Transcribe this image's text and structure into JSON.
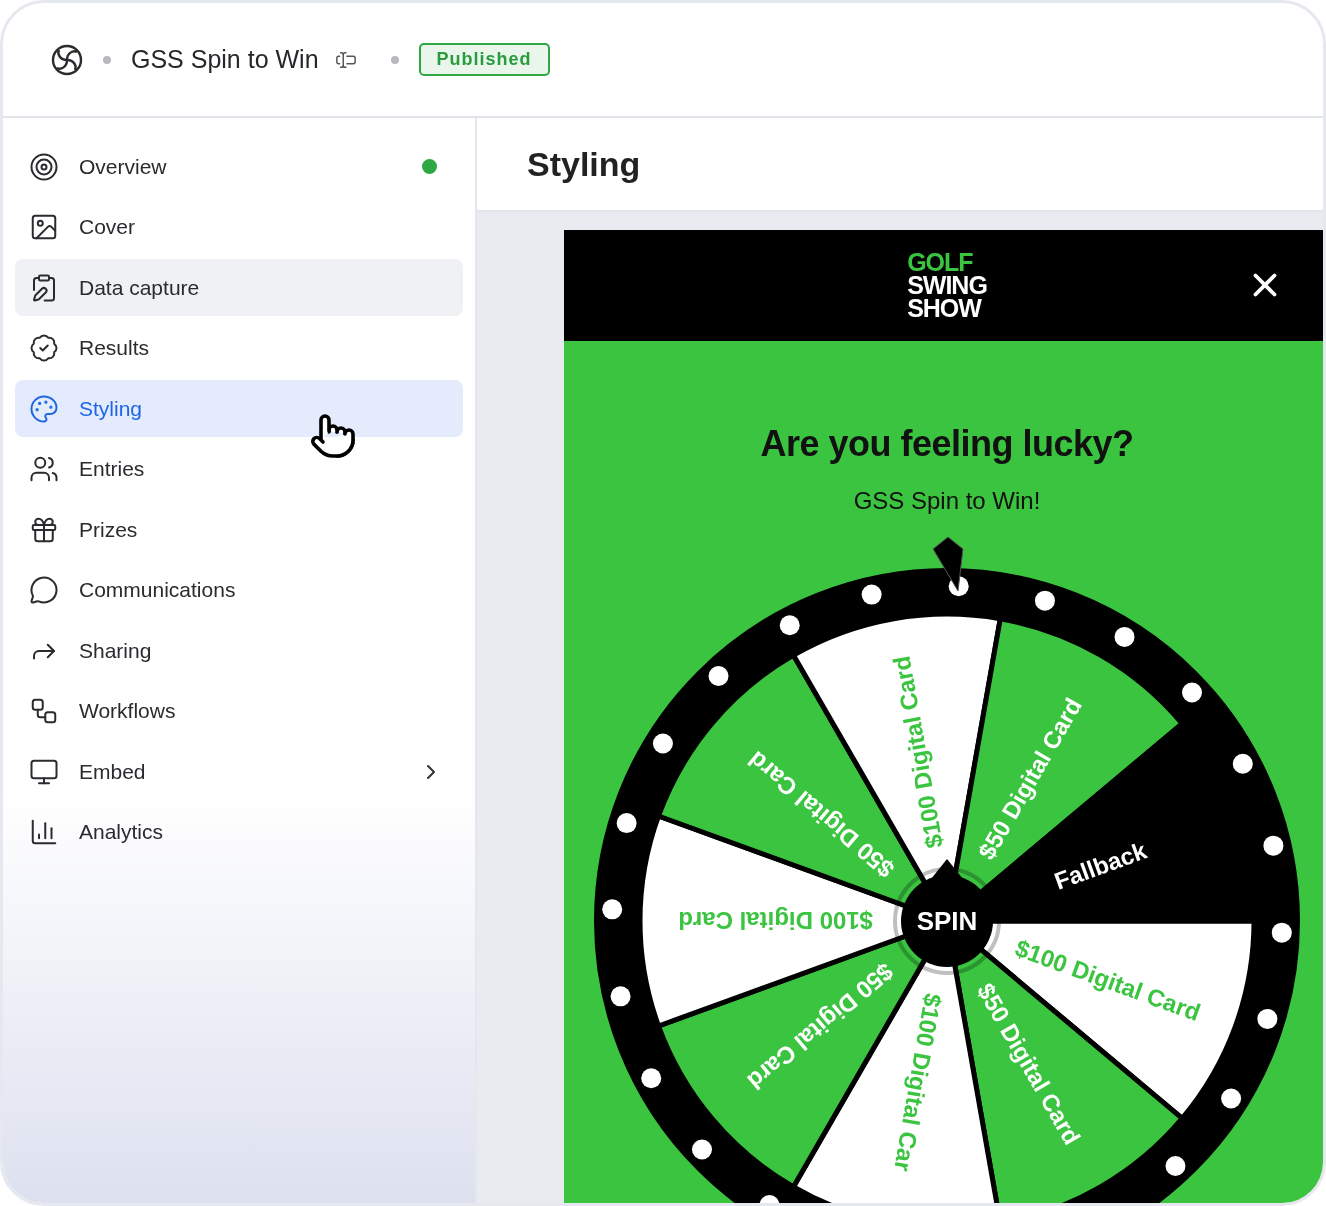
{
  "header": {
    "title": "GSS Spin to Win",
    "status": "Published"
  },
  "sidebar": {
    "items": [
      {
        "label": "Overview",
        "selected": false,
        "highlighted": false,
        "complete": true
      },
      {
        "label": "Cover",
        "selected": false,
        "highlighted": false
      },
      {
        "label": "Data capture",
        "selected": false,
        "highlighted": true
      },
      {
        "label": "Results",
        "selected": false,
        "highlighted": false
      },
      {
        "label": "Styling",
        "selected": true,
        "highlighted": false
      },
      {
        "label": "Entries",
        "selected": false,
        "highlighted": false
      },
      {
        "label": "Prizes",
        "selected": false,
        "highlighted": false
      },
      {
        "label": "Communications",
        "selected": false,
        "highlighted": false
      },
      {
        "label": "Sharing",
        "selected": false,
        "highlighted": false
      },
      {
        "label": "Workflows",
        "selected": false,
        "highlighted": false
      },
      {
        "label": "Embed",
        "selected": false,
        "highlighted": false,
        "expandable": true
      },
      {
        "label": "Analytics",
        "selected": false,
        "highlighted": false
      }
    ]
  },
  "main": {
    "title": "Styling"
  },
  "preview": {
    "logo": [
      "GOLF",
      "SWING",
      "SHOW"
    ],
    "heading": "Are you feeling lucky?",
    "subheading": "GSS Spin to Win!",
    "spin_button": "SPIN",
    "segments": [
      {
        "label": "$100 Digital Card",
        "kind": "white"
      },
      {
        "label": "$50 Digital Card",
        "kind": "green"
      },
      {
        "label": "$100 Digital Car",
        "kind": "white"
      },
      {
        "label": "$50 Digital Card",
        "kind": "green"
      },
      {
        "label": "$100 Digital Card",
        "kind": "white"
      },
      {
        "label": "$50 Digital Card",
        "kind": "green"
      },
      {
        "label": "$100 Digital Card",
        "kind": "white"
      },
      {
        "label": "$50 Digital Card",
        "kind": "green"
      },
      {
        "label": "Fallback",
        "kind": "black"
      }
    ]
  }
}
